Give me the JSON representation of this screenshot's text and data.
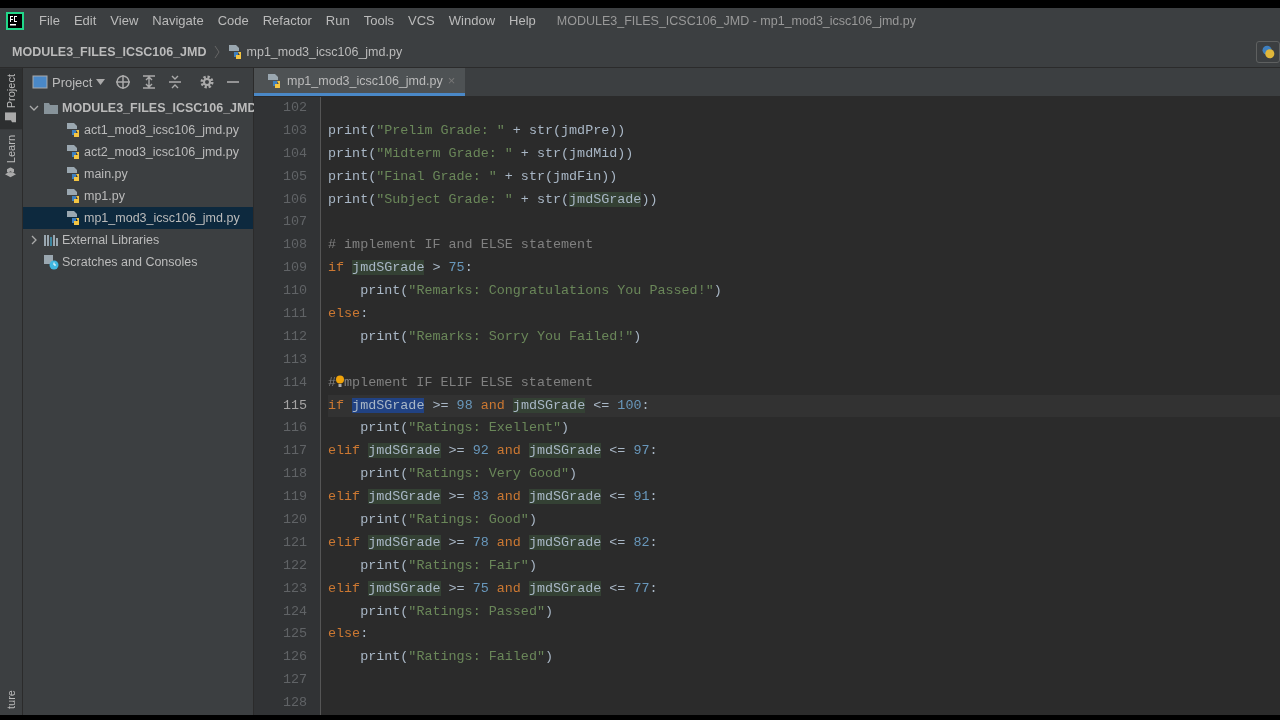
{
  "menu_bar": {
    "items": [
      "File",
      "Edit",
      "View",
      "Navigate",
      "Code",
      "Refactor",
      "Run",
      "Tools",
      "VCS",
      "Window",
      "Help"
    ],
    "title": "MODULE3_FILES_ICSC106_JMD - mp1_mod3_icsc106_jmd.py"
  },
  "breadcrumb": [
    "MODULE3_FILES_ICSC106_JMD",
    "mp1_mod3_icsc106_jmd.py"
  ],
  "side_strip": [
    {
      "label": "Project",
      "selected": true
    },
    {
      "label": "Learn",
      "selected": false
    },
    {
      "label": "ture",
      "selected": false
    }
  ],
  "project_panel": {
    "title": "Project",
    "tree": [
      {
        "label": "MODULE3_FILES_ICSC106_JMD",
        "kind": "folder",
        "expanded": true,
        "selected": false,
        "children": [
          {
            "label": "act1_mod3_icsc106_jmd.py",
            "kind": "python",
            "selected": false
          },
          {
            "label": "act2_mod3_icsc106_jmd.py",
            "kind": "python",
            "selected": false
          },
          {
            "label": "main.py",
            "kind": "python",
            "selected": false
          },
          {
            "label": "mp1.py",
            "kind": "python",
            "selected": false
          },
          {
            "label": "mp1_mod3_icsc106_jmd.py",
            "kind": "python",
            "selected": true
          }
        ]
      },
      {
        "label": "External Libraries",
        "kind": "libraries",
        "expanded": false,
        "selected": false
      },
      {
        "label": "Scratches and Consoles",
        "kind": "scratches",
        "selected": false
      }
    ]
  },
  "editor_tabs": [
    {
      "label": "mp1_mod3_icsc106_jmd.py",
      "selected": true,
      "close": "×"
    }
  ],
  "code_lines": [
    {
      "number": "102",
      "current": false
    },
    {
      "number": "103",
      "current": false,
      "tokens": [
        {
          "kind": "plain",
          "text": "print("
        },
        {
          "kind": "string",
          "text": "\"Prelim Grade: \""
        },
        {
          "kind": "plain",
          "text": " + str(jmdPre))"
        }
      ]
    },
    {
      "number": "104",
      "current": false,
      "tokens": [
        {
          "kind": "plain",
          "text": "print("
        },
        {
          "kind": "string",
          "text": "\"Midterm Grade: \""
        },
        {
          "kind": "plain",
          "text": " + str(jmdMid))"
        }
      ]
    },
    {
      "number": "105",
      "current": false,
      "tokens": [
        {
          "kind": "plain",
          "text": "print("
        },
        {
          "kind": "string",
          "text": "\"Final Grade: \""
        },
        {
          "kind": "plain",
          "text": " + str(jmdFin))"
        }
      ]
    },
    {
      "number": "106",
      "current": false,
      "tokens": [
        {
          "kind": "plain",
          "text": "print("
        },
        {
          "kind": "string",
          "text": "\"Subject Grade: \""
        },
        {
          "kind": "plain",
          "text": " + str("
        },
        {
          "kind": "usage",
          "text": "jmdSGrade"
        },
        {
          "kind": "plain",
          "text": "))"
        }
      ]
    },
    {
      "number": "107",
      "current": false
    },
    {
      "number": "108",
      "current": false,
      "tokens": [
        {
          "kind": "comment",
          "text": "# implement IF and ELSE statement"
        }
      ]
    },
    {
      "number": "109",
      "current": false,
      "tokens": [
        {
          "kind": "keyword",
          "text": "if "
        },
        {
          "kind": "usage",
          "text": "jmdSGrade"
        },
        {
          "kind": "plain",
          "text": " > "
        },
        {
          "kind": "number",
          "text": "75"
        },
        {
          "kind": "plain",
          "text": ":"
        }
      ]
    },
    {
      "number": "110",
      "current": false,
      "tokens": [
        {
          "kind": "plain",
          "text": "    print("
        },
        {
          "kind": "string",
          "text": "\"Remarks: Congratulations You Passed!\""
        },
        {
          "kind": "plain",
          "text": ")"
        }
      ]
    },
    {
      "number": "111",
      "current": false,
      "tokens": [
        {
          "kind": "keyword",
          "text": "else"
        },
        {
          "kind": "plain",
          "text": ":"
        }
      ]
    },
    {
      "number": "112",
      "current": false,
      "tokens": [
        {
          "kind": "plain",
          "text": "    print("
        },
        {
          "kind": "string",
          "text": "\"Remarks: Sorry You Failed!\""
        },
        {
          "kind": "plain",
          "text": ")"
        }
      ]
    },
    {
      "number": "113",
      "current": false
    },
    {
      "number": "114",
      "current": false,
      "tokens": [
        {
          "kind": "comment",
          "text": "#"
        },
        {
          "kind": "bulb"
        },
        {
          "kind": "comment",
          "text": "mplement IF ELIF ELSE statement"
        }
      ]
    },
    {
      "number": "115",
      "current": true,
      "tokens": [
        {
          "kind": "keyword",
          "text": "if "
        },
        {
          "kind": "selected",
          "text": "jmdSGrade"
        },
        {
          "kind": "plain",
          "text": " >= "
        },
        {
          "kind": "number",
          "text": "98"
        },
        {
          "kind": "keyword",
          "text": " and "
        },
        {
          "kind": "usage",
          "text": "jmdSGrade"
        },
        {
          "kind": "plain",
          "text": " <= "
        },
        {
          "kind": "number",
          "text": "100"
        },
        {
          "kind": "plain",
          "text": ":"
        }
      ]
    },
    {
      "number": "116",
      "current": false,
      "tokens": [
        {
          "kind": "plain",
          "text": "    print("
        },
        {
          "kind": "string",
          "text": "\"Ratings: Exellent\""
        },
        {
          "kind": "plain",
          "text": ")"
        }
      ]
    },
    {
      "number": "117",
      "current": false,
      "tokens": [
        {
          "kind": "keyword",
          "text": "elif "
        },
        {
          "kind": "usage",
          "text": "jmdSGrade"
        },
        {
          "kind": "plain",
          "text": " >= "
        },
        {
          "kind": "number",
          "text": "92"
        },
        {
          "kind": "keyword",
          "text": " and "
        },
        {
          "kind": "usage",
          "text": "jmdSGrade"
        },
        {
          "kind": "plain",
          "text": " <= "
        },
        {
          "kind": "number",
          "text": "97"
        },
        {
          "kind": "plain",
          "text": ":"
        }
      ]
    },
    {
      "number": "118",
      "current": false,
      "tokens": [
        {
          "kind": "plain",
          "text": "    print("
        },
        {
          "kind": "string",
          "text": "\"Ratings: Very Good\""
        },
        {
          "kind": "plain",
          "text": ")"
        }
      ]
    },
    {
      "number": "119",
      "current": false,
      "tokens": [
        {
          "kind": "keyword",
          "text": "elif "
        },
        {
          "kind": "usage",
          "text": "jmdSGrade"
        },
        {
          "kind": "plain",
          "text": " >= "
        },
        {
          "kind": "number",
          "text": "83"
        },
        {
          "kind": "keyword",
          "text": " and "
        },
        {
          "kind": "usage",
          "text": "jmdSGrade"
        },
        {
          "kind": "plain",
          "text": " <= "
        },
        {
          "kind": "number",
          "text": "91"
        },
        {
          "kind": "plain",
          "text": ":"
        }
      ]
    },
    {
      "number": "120",
      "current": false,
      "tokens": [
        {
          "kind": "plain",
          "text": "    print("
        },
        {
          "kind": "string",
          "text": "\"Ratings: Good\""
        },
        {
          "kind": "plain",
          "text": ")"
        }
      ]
    },
    {
      "number": "121",
      "current": false,
      "tokens": [
        {
          "kind": "keyword",
          "text": "elif "
        },
        {
          "kind": "usage",
          "text": "jmdSGrade"
        },
        {
          "kind": "plain",
          "text": " >= "
        },
        {
          "kind": "number",
          "text": "78"
        },
        {
          "kind": "keyword",
          "text": " and "
        },
        {
          "kind": "usage",
          "text": "jmdSGrade"
        },
        {
          "kind": "plain",
          "text": " <= "
        },
        {
          "kind": "number",
          "text": "82"
        },
        {
          "kind": "plain",
          "text": ":"
        }
      ]
    },
    {
      "number": "122",
      "current": false,
      "tokens": [
        {
          "kind": "plain",
          "text": "    print("
        },
        {
          "kind": "string",
          "text": "\"Ratings: Fair\""
        },
        {
          "kind": "plain",
          "text": ")"
        }
      ]
    },
    {
      "number": "123",
      "current": false,
      "tokens": [
        {
          "kind": "keyword",
          "text": "elif "
        },
        {
          "kind": "usage",
          "text": "jmdSGrade"
        },
        {
          "kind": "plain",
          "text": " >= "
        },
        {
          "kind": "number",
          "text": "75"
        },
        {
          "kind": "keyword",
          "text": " and "
        },
        {
          "kind": "usage",
          "text": "jmdSGrade"
        },
        {
          "kind": "plain",
          "text": " <= "
        },
        {
          "kind": "number",
          "text": "77"
        },
        {
          "kind": "plain",
          "text": ":"
        }
      ]
    },
    {
      "number": "124",
      "current": false,
      "tokens": [
        {
          "kind": "plain",
          "text": "    print("
        },
        {
          "kind": "string",
          "text": "\"Ratings: Passed\""
        },
        {
          "kind": "plain",
          "text": ")"
        }
      ]
    },
    {
      "number": "125",
      "current": false,
      "tokens": [
        {
          "kind": "keyword",
          "text": "else"
        },
        {
          "kind": "plain",
          "text": ":"
        }
      ]
    },
    {
      "number": "126",
      "current": false,
      "tokens": [
        {
          "kind": "plain",
          "text": "    print("
        },
        {
          "kind": "string",
          "text": "\"Ratings: Failed\""
        },
        {
          "kind": "plain",
          "text": ")"
        }
      ]
    },
    {
      "number": "127",
      "current": false
    },
    {
      "number": "128",
      "current": false
    }
  ]
}
